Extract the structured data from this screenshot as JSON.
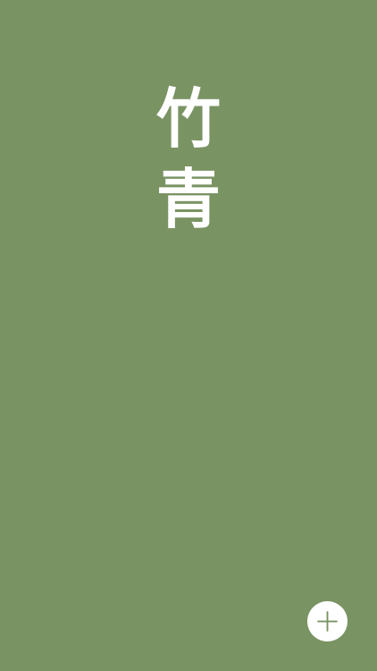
{
  "screen": {
    "background_color": "#7a9363"
  },
  "color_name": {
    "chars": [
      "竹",
      "青"
    ],
    "text_color": "#ffffff"
  },
  "add_button": {
    "icon": "plus-icon",
    "background_color": "#ffffff",
    "icon_color": "#7a9363"
  }
}
